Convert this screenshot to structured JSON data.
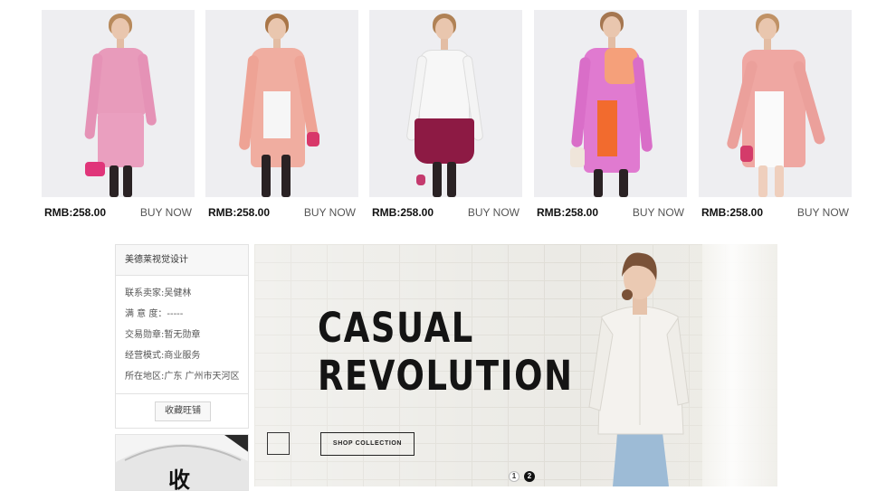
{
  "products": [
    {
      "price": "RMB:258.00",
      "buy": "BUY NOW",
      "outfit": "pink tweed jacket and skirt",
      "colors": {
        "coat": "#e89bbb",
        "legs": "#2a2224",
        "bag": "#e0357a"
      }
    },
    {
      "price": "RMB:258.00",
      "buy": "BUY NOW",
      "outfit": "peach long coat",
      "colors": {
        "coat": "#f0ada0",
        "legs": "#2a2224",
        "bag": "#d8386a"
      }
    },
    {
      "price": "RMB:258.00",
      "buy": "BUY NOW",
      "outfit": "white dotted sweater with burgundy skirt",
      "colors": {
        "coat": "#f7f7f7",
        "legs": "#2a2224",
        "bag": "#8d1a44"
      }
    },
    {
      "price": "RMB:258.00",
      "buy": "BUY NOW",
      "outfit": "pink and orange color-block coat",
      "colors": {
        "coat": "#e07ad0",
        "legs": "#2a2224",
        "bag": "#f26b2e"
      }
    },
    {
      "price": "RMB:258.00",
      "buy": "BUY NOW",
      "outfit": "light pink trench coat",
      "colors": {
        "coat": "#efa7a2",
        "legs": "#f2d6c6",
        "bag": "#f6f6f6"
      }
    }
  ],
  "shop": {
    "title": "美德莱视觉设计",
    "lines": [
      "联系卖家:吴健林",
      "满 意 度：-----",
      "交易勋章:暂无勋章",
      "经营模式:商业服务",
      "所在地区:广东 广州市天河区"
    ],
    "favorite_button": "收藏旺铺",
    "thumb_char": "收"
  },
  "hero": {
    "title_line1": "CASUAL",
    "title_line2": "REVOLUTION",
    "cta": "SHOP COLLECTION",
    "pager": [
      "1",
      "2"
    ],
    "active_page": "2"
  }
}
